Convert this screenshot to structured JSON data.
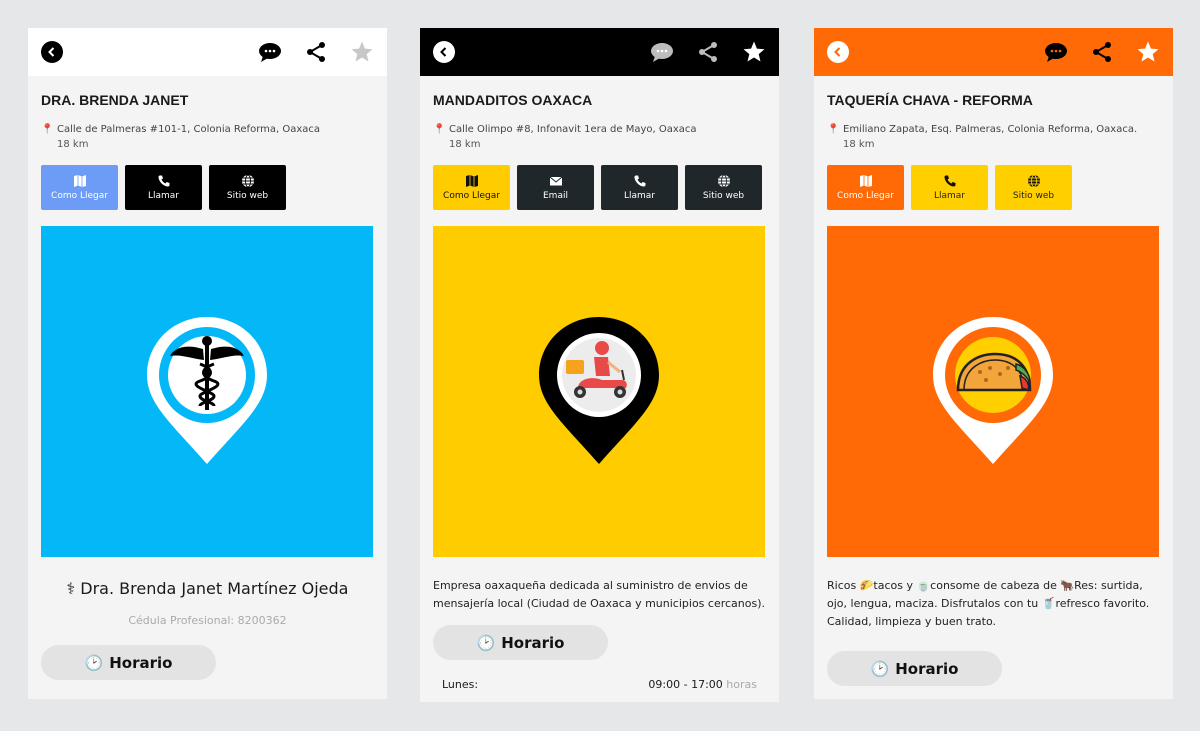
{
  "screens": [
    {
      "title": "DRA. BRENDA JANET",
      "address_line1": "Calle de Palmeras #101-1, Colonia Reforma, Oaxaca",
      "address_line2": "18 km",
      "buttons": [
        "Como Llegar",
        "Llamar",
        "Sitio web"
      ],
      "hero_color": "#04b7f7",
      "hero_icon": "caduceus-icon",
      "person_name": "⚕ Dra. Brenda Janet Martínez Ojeda",
      "cedula": "Cédula Profesional: 8200362",
      "horario_label": "Horario",
      "favorite_star": "gray"
    },
    {
      "title": "MANDADITOS OAXACA",
      "address_line1": "Calle Olimpo #8, Infonavit 1era de Mayo, Oaxaca",
      "address_line2": "18 km",
      "buttons": [
        "Como Llegar",
        "Email",
        "Llamar",
        "Sitio web"
      ],
      "hero_color": "#ffcc00",
      "hero_icon": "delivery-scooter-icon",
      "description": "Empresa oaxaqueña dedicada al suministro de envios de mensajería local (Ciudad de Oaxaca y municipios cercanos).",
      "horario_label": "Horario",
      "hours": {
        "day": "Lunes:",
        "time": "09:00 - 17:00",
        "unit": "horas"
      },
      "favorite_star": "white"
    },
    {
      "title": "TAQUERÍA CHAVA - REFORMA",
      "address_line1": "Emiliano Zapata, Esq. Palmeras, Colonia Reforma, Oaxaca.",
      "address_line2": "18 km",
      "buttons": [
        "Como Llegar",
        "Llamar",
        "Sitio web"
      ],
      "hero_color": "#ff6a07",
      "hero_icon": "taco-icon",
      "description": "Ricos 🌮tacos y 🍵consome de cabeza de 🐂Res: surtida, ojo, lengua, maciza. Disfrutalos con tu 🥤refresco favorito. Calidad, limpieza y buen trato.",
      "horario_label": "Horario",
      "favorite_star": "white"
    }
  ]
}
